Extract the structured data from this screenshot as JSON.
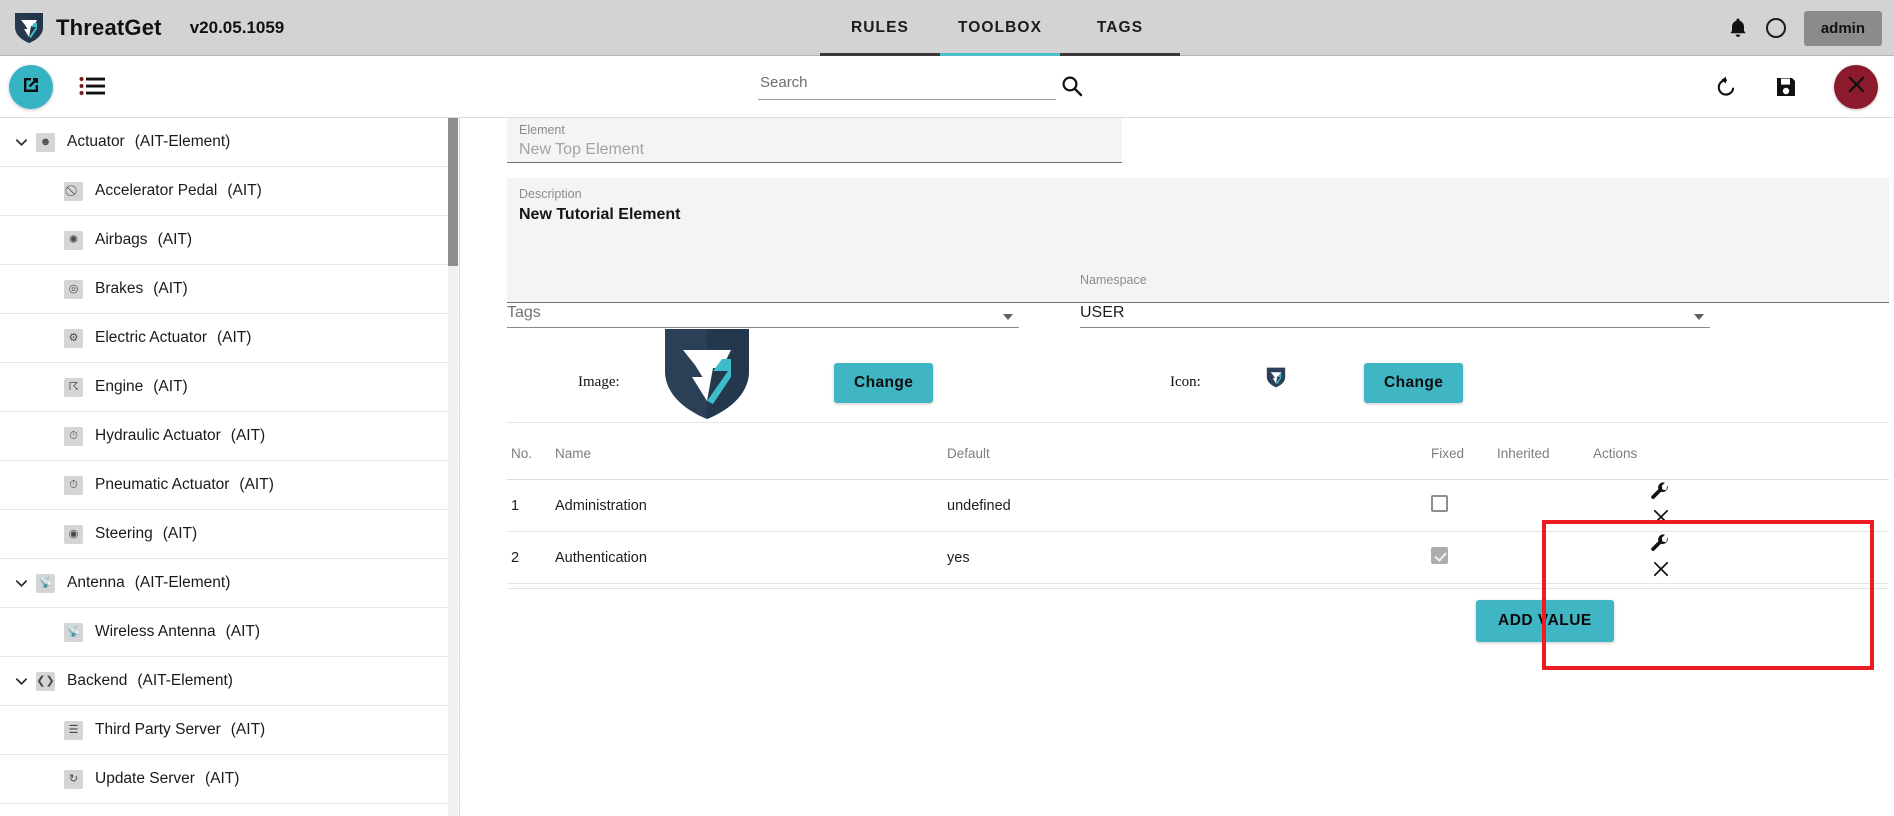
{
  "header": {
    "logo_icon": "threatget-shield-logo",
    "app_name": "ThreatGet",
    "version": "v20.05.1059",
    "tabs": [
      {
        "label": "RULES",
        "active": false
      },
      {
        "label": "TOOLBOX",
        "active": true
      },
      {
        "label": "TAGS",
        "active": false
      }
    ],
    "notifications_icon": "bell-icon",
    "status_icon": "circle-icon",
    "user_label": "admin",
    "accent_color": "#4cbcc8",
    "bar_color": "#d3d3d3"
  },
  "toolbar": {
    "new_element_icon": "external-link-icon",
    "list_icon": "list-icon",
    "search": {
      "placeholder": "Search",
      "value": ""
    },
    "search_icon": "magnifier-icon",
    "refresh_icon": "undo-icon",
    "save_icon": "save-floppy-icon",
    "close_icon": "close-x-icon",
    "fab_color": "#36b4c4",
    "close_color": "#8b1b2c"
  },
  "sidebar": {
    "items": [
      {
        "name": "Actuator",
        "type": "(AIT-Element)",
        "level": "parent",
        "expanded": true,
        "icon": "actuator-icon"
      },
      {
        "name": "Accelerator Pedal",
        "type": "(AIT)",
        "level": "child",
        "icon": "accelerator-pedal-icon"
      },
      {
        "name": "Airbags",
        "type": "(AIT)",
        "level": "child",
        "icon": "airbag-icon"
      },
      {
        "name": "Brakes",
        "type": "(AIT)",
        "level": "child",
        "icon": "brakes-icon"
      },
      {
        "name": "Electric Actuator",
        "type": "(AIT)",
        "level": "child",
        "icon": "electric-actuator-icon"
      },
      {
        "name": "Engine",
        "type": "(AIT)",
        "level": "child",
        "icon": "engine-icon"
      },
      {
        "name": "Hydraulic Actuator",
        "type": "(AIT)",
        "level": "child",
        "icon": "hydraulic-actuator-icon"
      },
      {
        "name": "Pneumatic Actuator",
        "type": "(AIT)",
        "level": "child",
        "icon": "pneumatic-actuator-icon"
      },
      {
        "name": "Steering",
        "type": "(AIT)",
        "level": "child",
        "icon": "steering-icon"
      },
      {
        "name": "Antenna",
        "type": "(AIT-Element)",
        "level": "parent",
        "expanded": true,
        "icon": "antenna-icon"
      },
      {
        "name": "Wireless Antenna",
        "type": "(AIT)",
        "level": "child",
        "icon": "antenna-icon"
      },
      {
        "name": "Backend",
        "type": "(AIT-Element)",
        "level": "parent",
        "expanded": true,
        "icon": "code-icon"
      },
      {
        "name": "Third Party Server",
        "type": "(AIT)",
        "level": "child",
        "icon": "server-icon"
      },
      {
        "name": "Update Server",
        "type": "(AIT)",
        "level": "child",
        "icon": "update-server-icon"
      }
    ]
  },
  "main": {
    "element_field": {
      "label": "Element",
      "value": "New Top Element"
    },
    "description_field": {
      "label": "Description",
      "value": "New Tutorial Element"
    },
    "tags_select": {
      "label": "Tags",
      "value": "",
      "placeholder": "Tags"
    },
    "namespace_select": {
      "label": "Namespace",
      "value": "USER"
    },
    "image": {
      "label": "Image:",
      "icon": "threatget-shield-logo",
      "change_label": "Change"
    },
    "icon": {
      "label": "Icon:",
      "icon": "threatget-shield-small",
      "change_label": "Change"
    },
    "table": {
      "columns": [
        "No.",
        "Name",
        "Default",
        "Fixed",
        "Inherited",
        "Actions"
      ],
      "rows": [
        {
          "no": "1",
          "name": "Administration",
          "default": "undefined",
          "fixed": false,
          "fixed_disabled": false,
          "inherited": "",
          "edit_icon": "wrench-icon",
          "delete_icon": "close-x-icon"
        },
        {
          "no": "2",
          "name": "Authentication",
          "default": "yes",
          "fixed": true,
          "fixed_disabled": true,
          "inherited": "",
          "edit_icon": "wrench-icon",
          "delete_icon": "close-x-icon"
        }
      ]
    },
    "add_value_label": "ADD VALUE",
    "highlight_box_color": "#ed1c24",
    "button_color": "#40b5c3"
  }
}
